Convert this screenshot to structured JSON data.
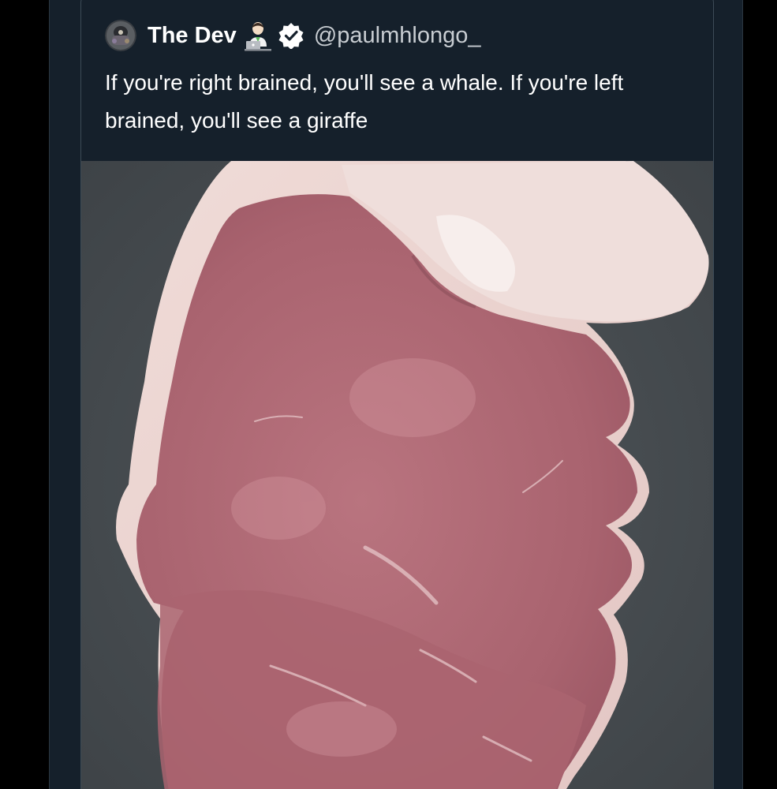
{
  "tweet": {
    "display_name": "The Dev",
    "handle": "@paulmhlongo_",
    "text": "If you're right brained, you'll see a whale. If you're left brained, you'll see a giraffe",
    "icons": {
      "avatar": "profile-avatar",
      "emoji": "technologist-emoji",
      "verified": "verified-badge-icon"
    }
  },
  "media": {
    "subject": "raw-steak-photo",
    "colors": {
      "background": "#4a5054",
      "meat": "#b06a78",
      "fat": "#ead4d0"
    }
  },
  "colors": {
    "page_background": "#000000",
    "card_background": "#15202b",
    "text_primary": "#ffffff",
    "text_secondary": "#c8cdd2"
  }
}
